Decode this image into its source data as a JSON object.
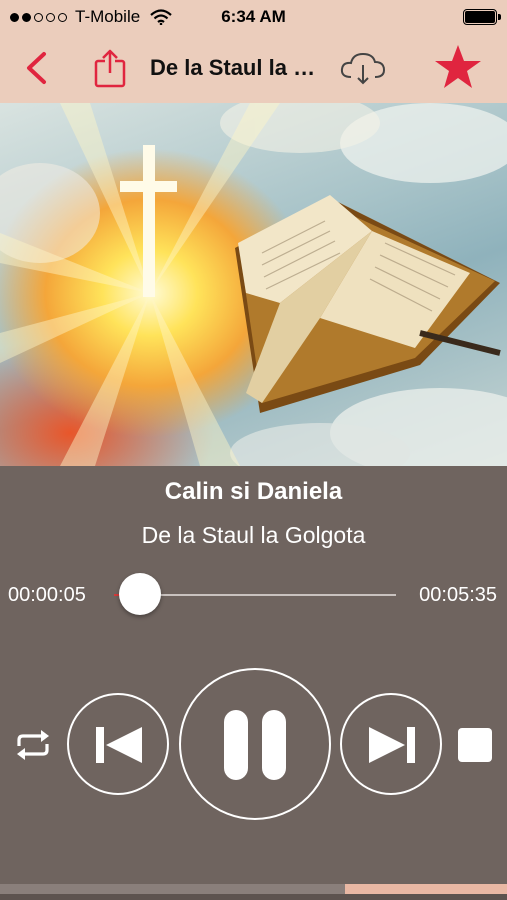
{
  "status_bar": {
    "carrier": "T-Mobile",
    "time": "6:34 AM",
    "signal_bars_filled": 2,
    "signal_bars_total": 5
  },
  "nav": {
    "title": "De la Staul la Golgota",
    "icons": [
      "back-chevron-icon",
      "share-icon",
      "cloud-download-icon",
      "favorite-star-icon"
    ],
    "accent_color": "#e0253f"
  },
  "artwork": {
    "description_icons": [
      "cross-icon",
      "bible-icon"
    ]
  },
  "player": {
    "artist": "Calin si Daniela",
    "album": "De la Staul la Golgota",
    "elapsed": "00:00:05",
    "duration": "00:05:35",
    "progress_fraction": 0.015,
    "controls": [
      "repeat-icon",
      "previous-icon",
      "pause-icon",
      "next-icon",
      "stop-icon"
    ]
  },
  "buffer": {
    "progress_fraction": 0.68
  },
  "colors": {
    "header_bg": "#ebcdbc",
    "player_bg": "#6f645f",
    "accent": "#e0253f"
  }
}
